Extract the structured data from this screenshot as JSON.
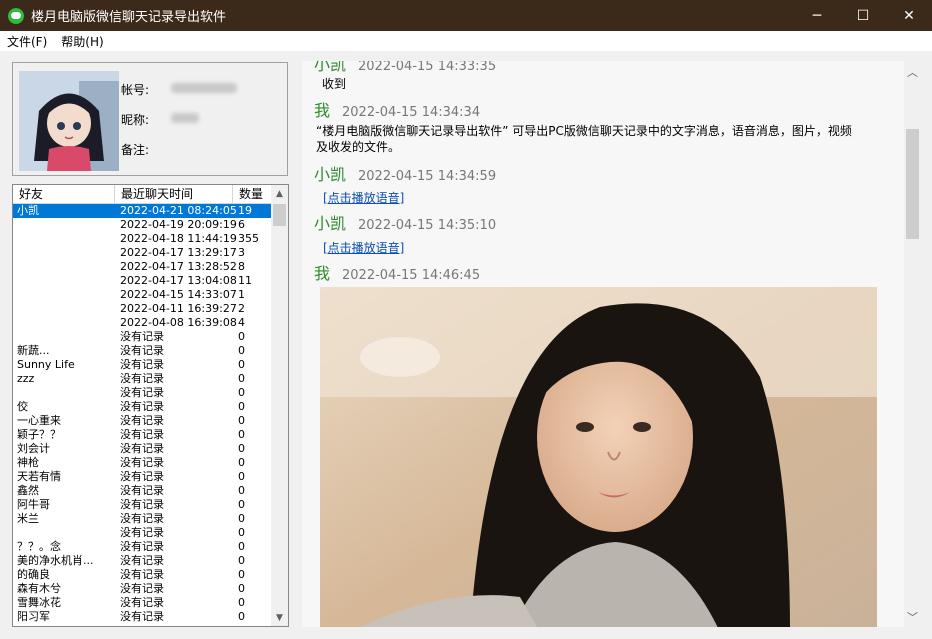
{
  "window": {
    "title": "楼月电脑版微信聊天记录导出软件",
    "minimize": "─",
    "maximize": "☐",
    "close": "✕"
  },
  "menu": [
    "文件(F)",
    "帮助(H)"
  ],
  "profile": {
    "account_label": "帐号:",
    "nickname_label": "昵称:",
    "remark_label": "备注:"
  },
  "list": {
    "columns": [
      "好友",
      "最近聊天时间",
      "数量"
    ],
    "rows": [
      {
        "name": "小凯",
        "time": "2022-04-21 08:24:05",
        "count": "19"
      },
      {
        "name": "",
        "time": "2022-04-19 20:09:19",
        "count": "6"
      },
      {
        "name": "",
        "time": "2022-04-18 11:44:19",
        "count": "355"
      },
      {
        "name": "",
        "time": "2022-04-17 13:29:17",
        "count": "3"
      },
      {
        "name": "",
        "time": "2022-04-17 13:28:52",
        "count": "8"
      },
      {
        "name": "",
        "time": "2022-04-17 13:04:08",
        "count": "11"
      },
      {
        "name": "",
        "time": "2022-04-15 14:33:07",
        "count": "1"
      },
      {
        "name": "",
        "time": "2022-04-11 16:39:27",
        "count": "2"
      },
      {
        "name": "",
        "time": "2022-04-08 16:39:08",
        "count": "4"
      },
      {
        "name": "",
        "time": "没有记录",
        "count": "0"
      },
      {
        "name": "新蔬...",
        "time": "没有记录",
        "count": "0"
      },
      {
        "name": "Sunny Life",
        "time": "没有记录",
        "count": "0"
      },
      {
        "name": "zzz",
        "time": "没有记录",
        "count": "0"
      },
      {
        "name": "",
        "time": "没有记录",
        "count": "0"
      },
      {
        "name": "佼",
        "time": "没有记录",
        "count": "0"
      },
      {
        "name": "一心重来",
        "time": "没有记录",
        "count": "0"
      },
      {
        "name": "颖子？？",
        "time": "没有记录",
        "count": "0"
      },
      {
        "name": "刘会计",
        "time": "没有记录",
        "count": "0"
      },
      {
        "name": "神枪",
        "time": "没有记录",
        "count": "0"
      },
      {
        "name": "天若有情",
        "time": "没有记录",
        "count": "0"
      },
      {
        "name": "鑫然",
        "time": "没有记录",
        "count": "0"
      },
      {
        "name": "阿牛哥",
        "time": "没有记录",
        "count": "0"
      },
      {
        "name": "米兰",
        "time": "没有记录",
        "count": "0"
      },
      {
        "name": "",
        "time": "没有记录",
        "count": "0"
      },
      {
        "name": "？？。念",
        "time": "没有记录",
        "count": "0"
      },
      {
        "name": "美的净水机肖...",
        "time": "没有记录",
        "count": "0"
      },
      {
        "name": "的确良",
        "time": "没有记录",
        "count": "0"
      },
      {
        "name": "森有木兮",
        "time": "没有记录",
        "count": "0"
      },
      {
        "name": "雪舞冰花",
        "time": "没有记录",
        "count": "0"
      },
      {
        "name": "阳习军",
        "time": "没有记录",
        "count": "0"
      }
    ]
  },
  "chat": {
    "messages": [
      {
        "sender": "小凯",
        "time": "2022-04-15 14:33:35",
        "text": "收到"
      },
      {
        "sender": "我",
        "time": "2022-04-15 14:34:34",
        "text": "“楼月电脑版微信聊天记录导出软件” 可导出PC版微信聊天记录中的文字消息，语音消息，图片，视频",
        "text2": "及收发的文件。"
      },
      {
        "sender": "小凯",
        "time": "2022-04-15 14:34:59",
        "link": "[点击播放语音]"
      },
      {
        "sender": "小凯",
        "time": "2022-04-15 14:35:10",
        "link": "[点击播放语音]"
      },
      {
        "sender": "我",
        "time": "2022-04-15 14:46:45"
      }
    ]
  },
  "icons": {
    "scroll_up": "▲",
    "scroll_down": "▼",
    "chevron_up": "︿",
    "chevron_down": "﹀"
  }
}
